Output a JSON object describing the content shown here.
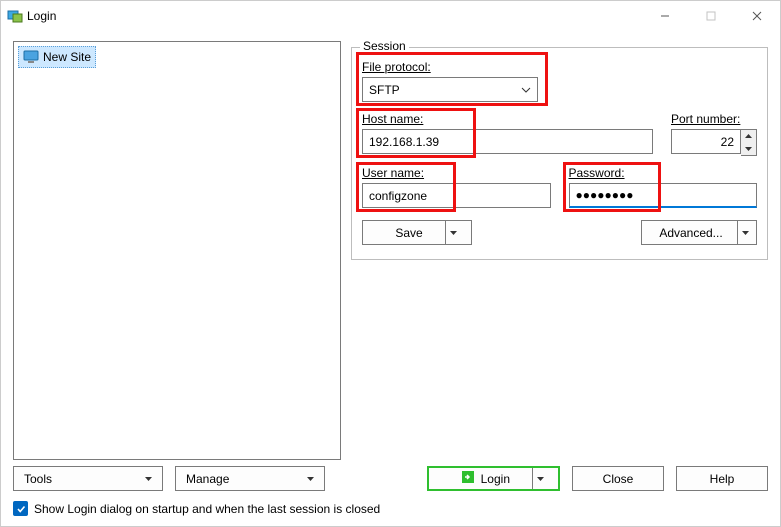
{
  "window": {
    "title": "Login"
  },
  "tree": {
    "new_site": "New Site"
  },
  "session": {
    "legend": "Session",
    "file_protocol_label": "File protocol:",
    "file_protocol_value": "SFTP",
    "host_label": "Host name:",
    "host_value": "192.168.1.39",
    "port_label": "Port number:",
    "port_value": "22",
    "user_label": "User name:",
    "user_value": "configzone",
    "password_label": "Password:",
    "password_value": "●●●●●●●●",
    "save": "Save",
    "advanced": "Advanced..."
  },
  "buttons": {
    "tools": "Tools",
    "manage": "Manage",
    "login": "Login",
    "close": "Close",
    "help": "Help"
  },
  "checkbox": {
    "label": "Show Login dialog on startup and when the last session is closed"
  }
}
